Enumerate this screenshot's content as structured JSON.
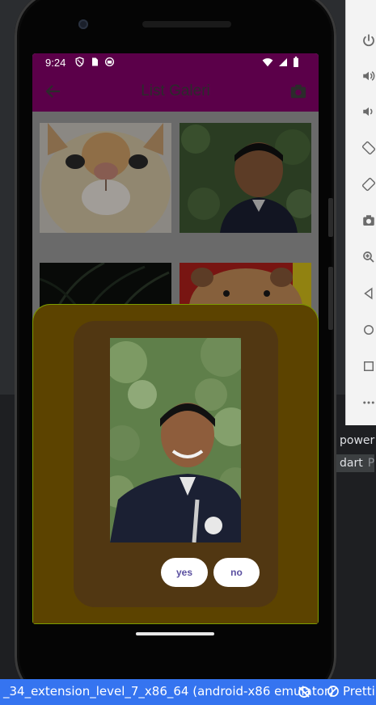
{
  "emulator": {
    "status_bar": {
      "time": "9:24",
      "left_icons": [
        "shield-icon",
        "sim-card-icon",
        "app-icon"
      ],
      "right_icons": [
        "wifi-icon",
        "signal-icon",
        "battery-icon"
      ]
    },
    "app_bar": {
      "title": "List Galeri",
      "back_icon": "arrow-left-icon",
      "action_icon": "camera-icon"
    },
    "gallery": {
      "items": [
        "cat-photo",
        "boy-photo",
        "plant-photo",
        "hamster-photo"
      ]
    },
    "dialog": {
      "yes_label": "yes",
      "no_label": "no"
    },
    "colors": {
      "app_bar": "#5b0049",
      "sheet": "#5c4300",
      "dialog": "#513712",
      "button_text": "#5a4fa0"
    }
  },
  "ide": {
    "toolbar_icons": [
      "power-icon",
      "volume-up-icon",
      "volume-down-icon",
      "rotate-left-icon",
      "rotate-right-icon",
      "screenshot-icon",
      "zoom-icon",
      "back-icon",
      "home-icon",
      "overview-icon",
      "more-icon"
    ],
    "side_label_1": "power",
    "side_label_2_main": "dart",
    "side_label_2_dim": "P",
    "statusbar": {
      "run_text": "_34_extension_level_7_x86_64 (android-x86 emulator)",
      "pretty_text": "Pretti"
    }
  }
}
